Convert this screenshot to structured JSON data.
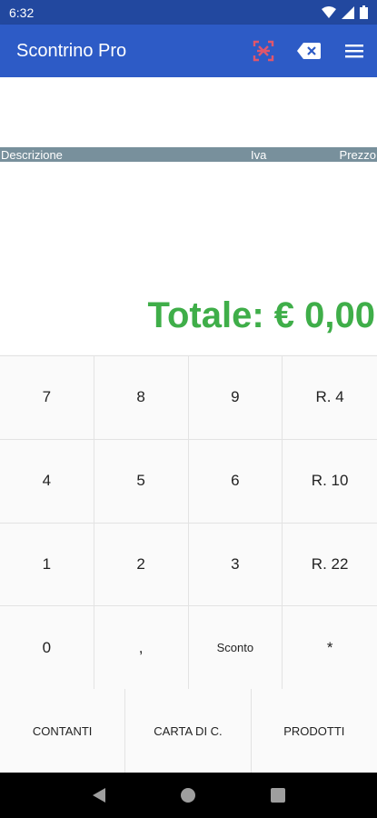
{
  "status_bar": {
    "time": "6:32"
  },
  "app_bar": {
    "title": "Scontrino Pro"
  },
  "table_header": {
    "description": "Descrizione",
    "vat": "Iva",
    "price": "Prezzo"
  },
  "total": {
    "text": "Totale: € 0,00"
  },
  "keypad": {
    "keys": [
      "7",
      "8",
      "9",
      "R. 4",
      "4",
      "5",
      "6",
      "R. 10",
      "1",
      "2",
      "3",
      "R. 22",
      "0",
      ",",
      "Sconto",
      "*"
    ]
  },
  "payment": {
    "cash": "CONTANTI",
    "card": "CARTA DI C.",
    "products": "PRODOTTI"
  },
  "colors": {
    "status_bar": "#22489f",
    "app_bar": "#2d5bc6",
    "header_row": "#78909c",
    "total": "#3fae49",
    "scan_icon": "#e0566b"
  }
}
